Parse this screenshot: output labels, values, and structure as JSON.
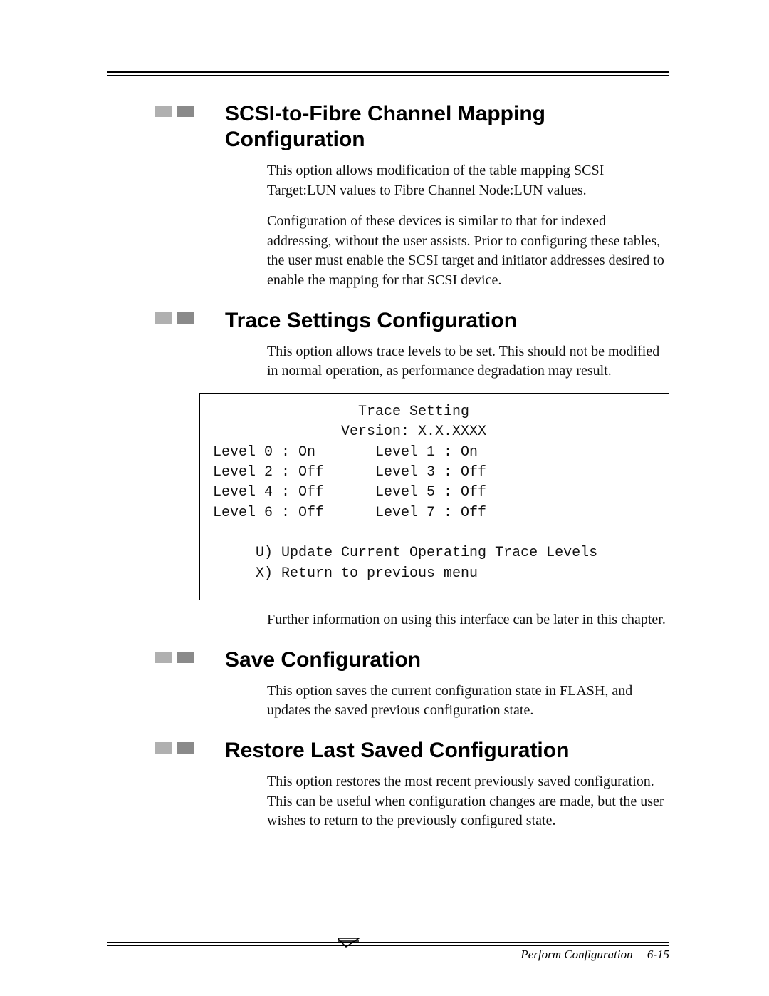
{
  "sections": [
    {
      "heading": "SCSI-to-Fibre Channel Mapping Configuration",
      "paragraphs": [
        "This option allows modification of the table mapping SCSI Target:LUN values to Fibre Channel Node:LUN values.",
        "Configuration of these devices is similar to that for indexed addressing, without the user assists. Prior to configuring these tables, the user must enable the SCSI target and initiator addresses desired to enable the mapping for that SCSI device."
      ]
    },
    {
      "heading": "Trace Settings Configuration",
      "paragraphs": [
        "This option allows trace levels to be set. This should not be modified in normal operation, as performance degradation may result."
      ],
      "code": "                 Trace Setting\n               Version: X.X.XXXX\nLevel 0 : On       Level 1 : On\nLevel 2 : Off      Level 3 : Off\nLevel 4 : Off      Level 5 : Off\nLevel 6 : Off      Level 7 : Off\n\n     U) Update Current Operating Trace Levels\n     X) Return to previous menu",
      "after_paragraphs": [
        "Further information on using this interface can be later in this chapter."
      ]
    },
    {
      "heading": "Save Configuration",
      "paragraphs": [
        "This option saves the current configuration state in FLASH, and updates the saved previous configuration state."
      ]
    },
    {
      "heading": "Restore Last Saved Configuration",
      "paragraphs": [
        "This option restores the most recent previously saved configuration. This can be useful when configuration changes are made, but the user wishes to return to the previously configured state."
      ]
    }
  ],
  "footer": {
    "label": "Perform Configuration",
    "page": "6-15"
  }
}
